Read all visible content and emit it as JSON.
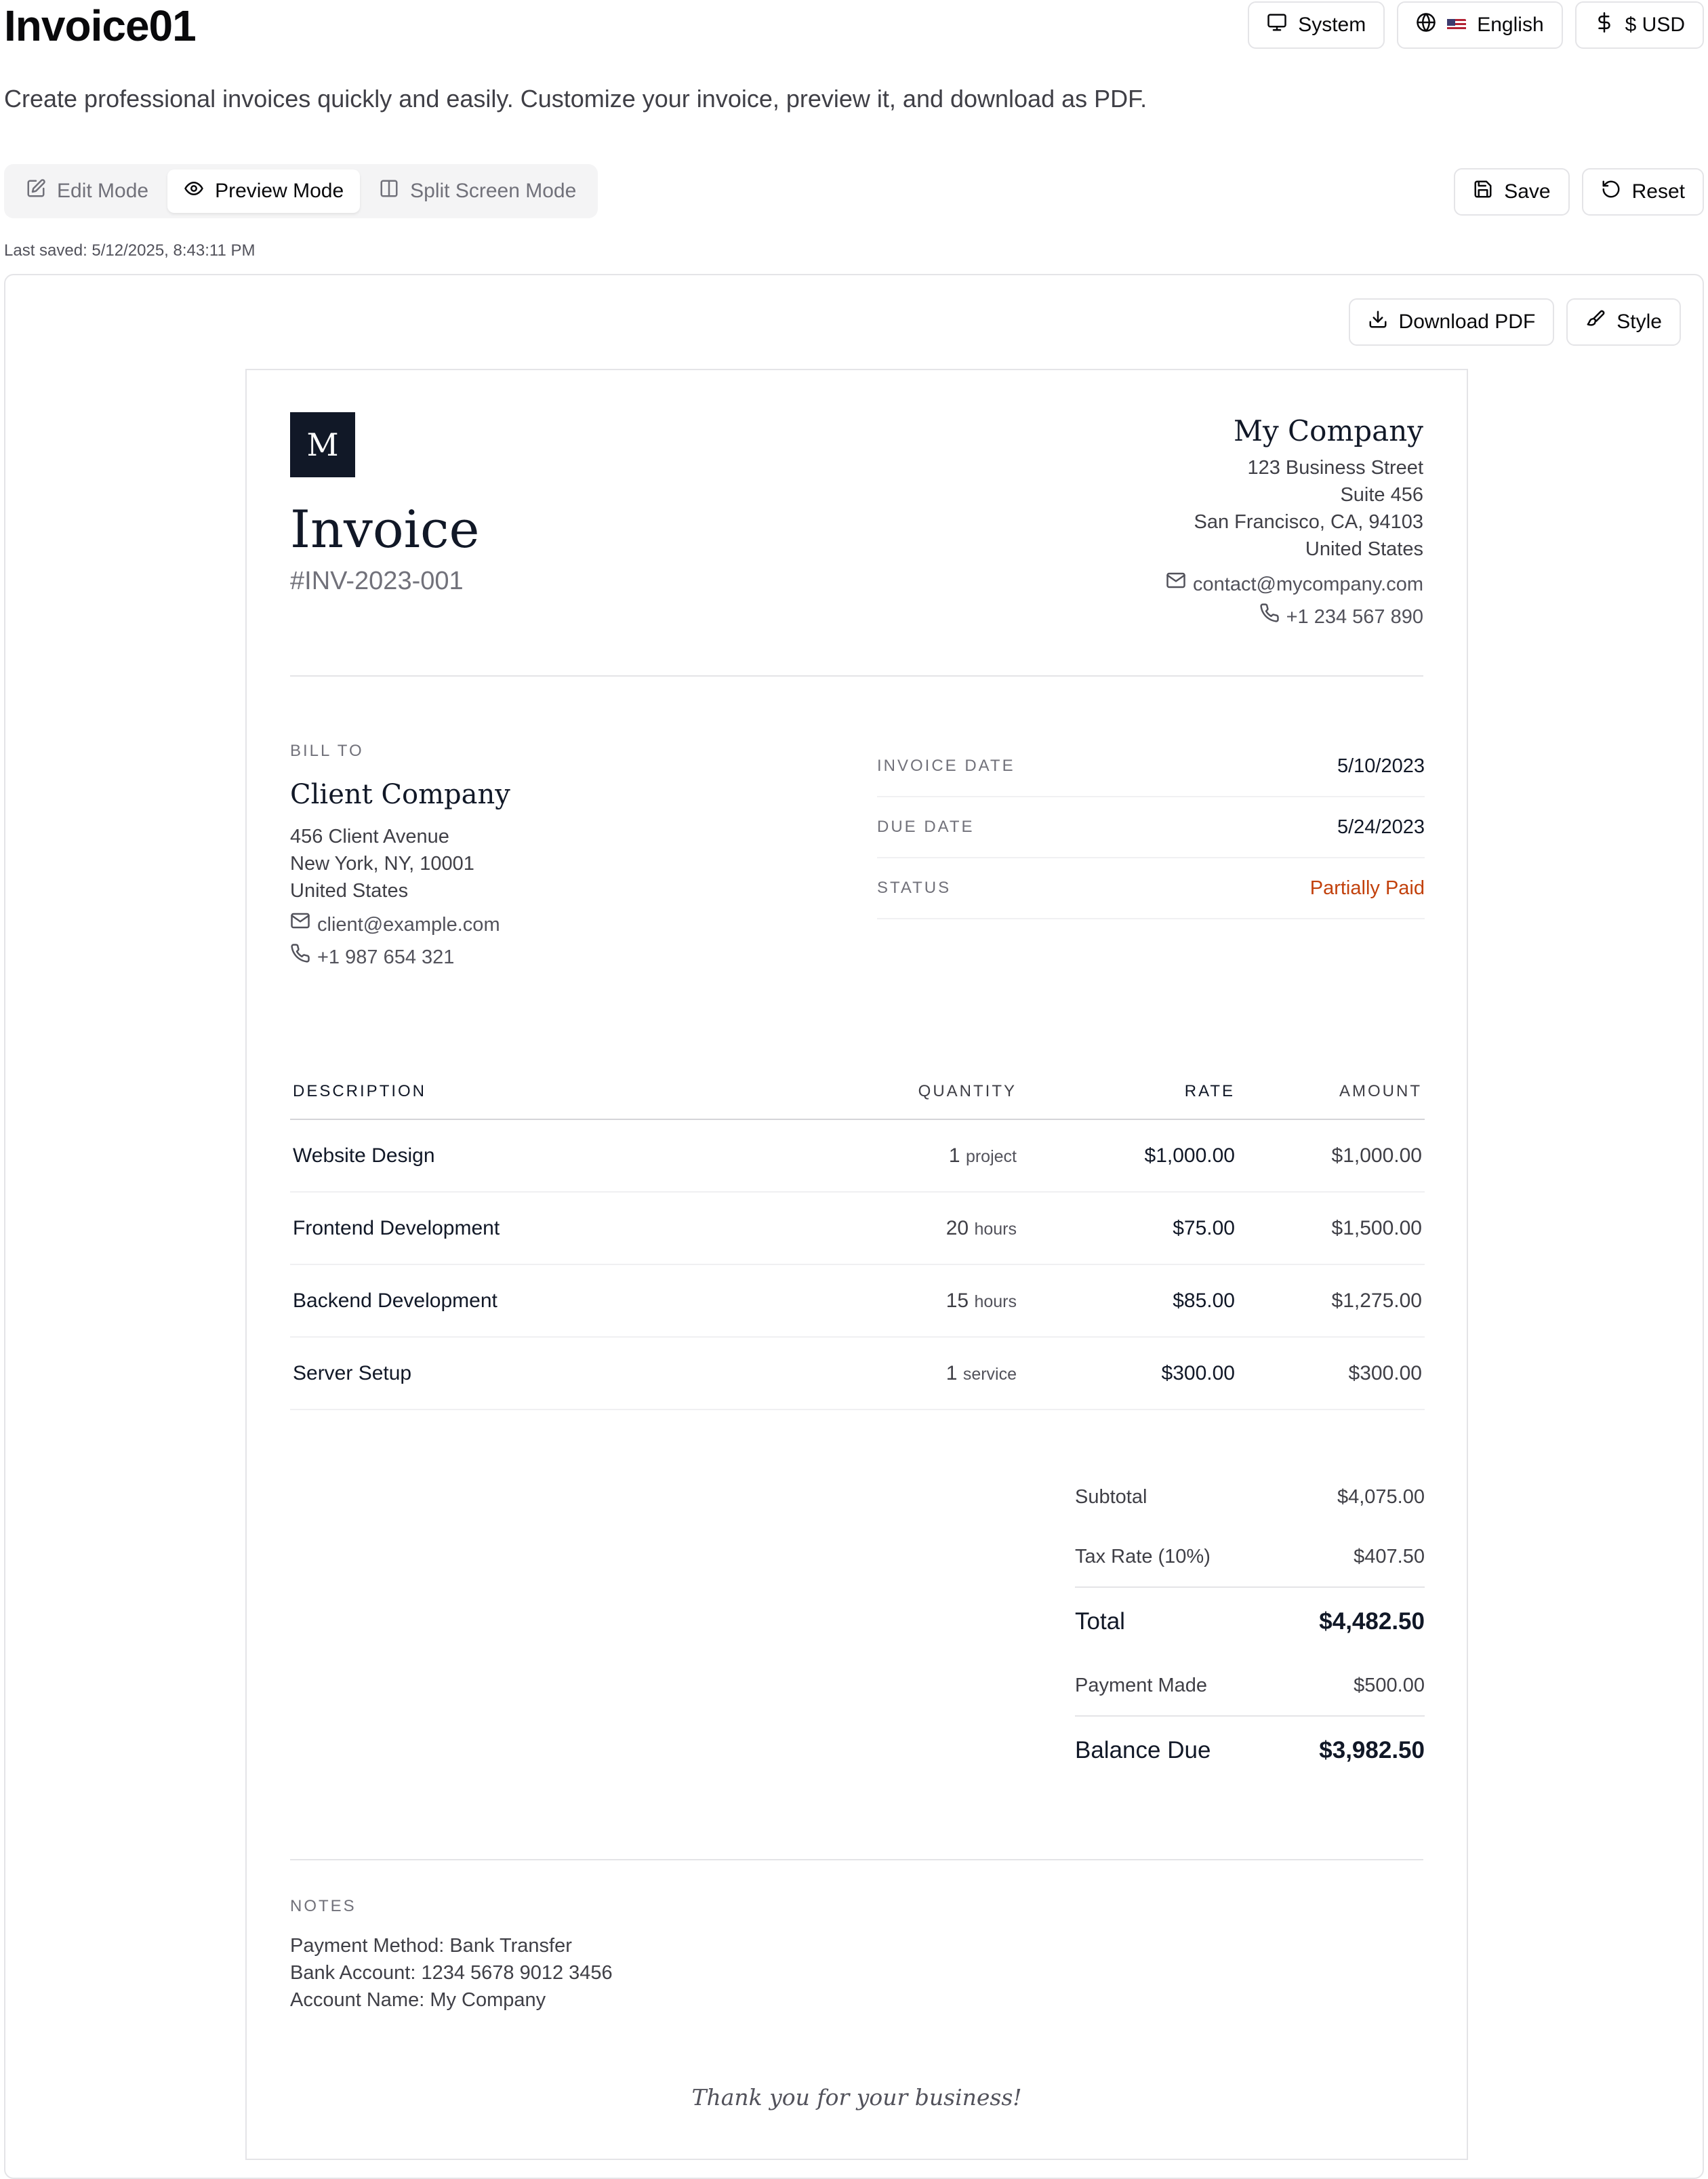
{
  "app": {
    "title": "Invoice01",
    "subtitle": "Create professional invoices quickly and easily. Customize your invoice, preview it, and download as PDF."
  },
  "top_controls": {
    "theme_label": "System",
    "language_label": "English",
    "currency_label": "$ USD"
  },
  "modes": [
    {
      "label": "Edit Mode",
      "active": false
    },
    {
      "label": "Preview Mode",
      "active": true
    },
    {
      "label": "Split Screen Mode",
      "active": false
    }
  ],
  "actions": {
    "save_label": "Save",
    "reset_label": "Reset"
  },
  "last_saved": "Last saved: 5/12/2025, 8:43:11 PM",
  "preview_actions": {
    "download_label": "Download PDF",
    "style_label": "Style"
  },
  "invoice": {
    "logo_letter": "M",
    "title": "Invoice",
    "number": "#INV-2023-001",
    "company": {
      "name": "My Company",
      "address": [
        "123 Business Street",
        "Suite 456",
        "San Francisco, CA, 94103",
        "United States"
      ],
      "email": "contact@mycompany.com",
      "phone": "+1 234 567 890"
    },
    "bill_to": {
      "label": "BILL TO",
      "name": "Client Company",
      "address": [
        "456 Client Avenue",
        "New York, NY, 10001",
        "United States"
      ],
      "email": "client@example.com",
      "phone": "+1 987 654 321"
    },
    "meta": [
      {
        "label": "INVOICE DATE",
        "value": "5/10/2023"
      },
      {
        "label": "DUE DATE",
        "value": "5/24/2023"
      },
      {
        "label": "STATUS",
        "value": "Partially Paid"
      }
    ],
    "status_color": "#c2410c",
    "table": {
      "headers": [
        "DESCRIPTION",
        "QUANTITY",
        "RATE",
        "AMOUNT"
      ],
      "rows": [
        {
          "description": "Website Design",
          "qty": "1",
          "unit": "project",
          "rate": "$1,000.00",
          "amount": "$1,000.00"
        },
        {
          "description": "Frontend Development",
          "qty": "20",
          "unit": "hours",
          "rate": "$75.00",
          "amount": "$1,500.00"
        },
        {
          "description": "Backend Development",
          "qty": "15",
          "unit": "hours",
          "rate": "$85.00",
          "amount": "$1,275.00"
        },
        {
          "description": "Server Setup",
          "qty": "1",
          "unit": "service",
          "rate": "$300.00",
          "amount": "$300.00"
        }
      ]
    },
    "totals": {
      "subtotal_label": "Subtotal",
      "subtotal": "$4,075.00",
      "tax_label": "Tax Rate (10%)",
      "tax": "$407.50",
      "total_label": "Total",
      "total": "$4,482.50",
      "paid_label": "Payment Made",
      "paid": "$500.00",
      "balance_label": "Balance Due",
      "balance": "$3,982.50"
    },
    "notes": {
      "label": "NOTES",
      "lines": [
        "Payment Method: Bank Transfer",
        "Bank Account: 1234 5678 9012 3456",
        "Account Name: My Company"
      ]
    },
    "thanks": "Thank you for your business!"
  }
}
